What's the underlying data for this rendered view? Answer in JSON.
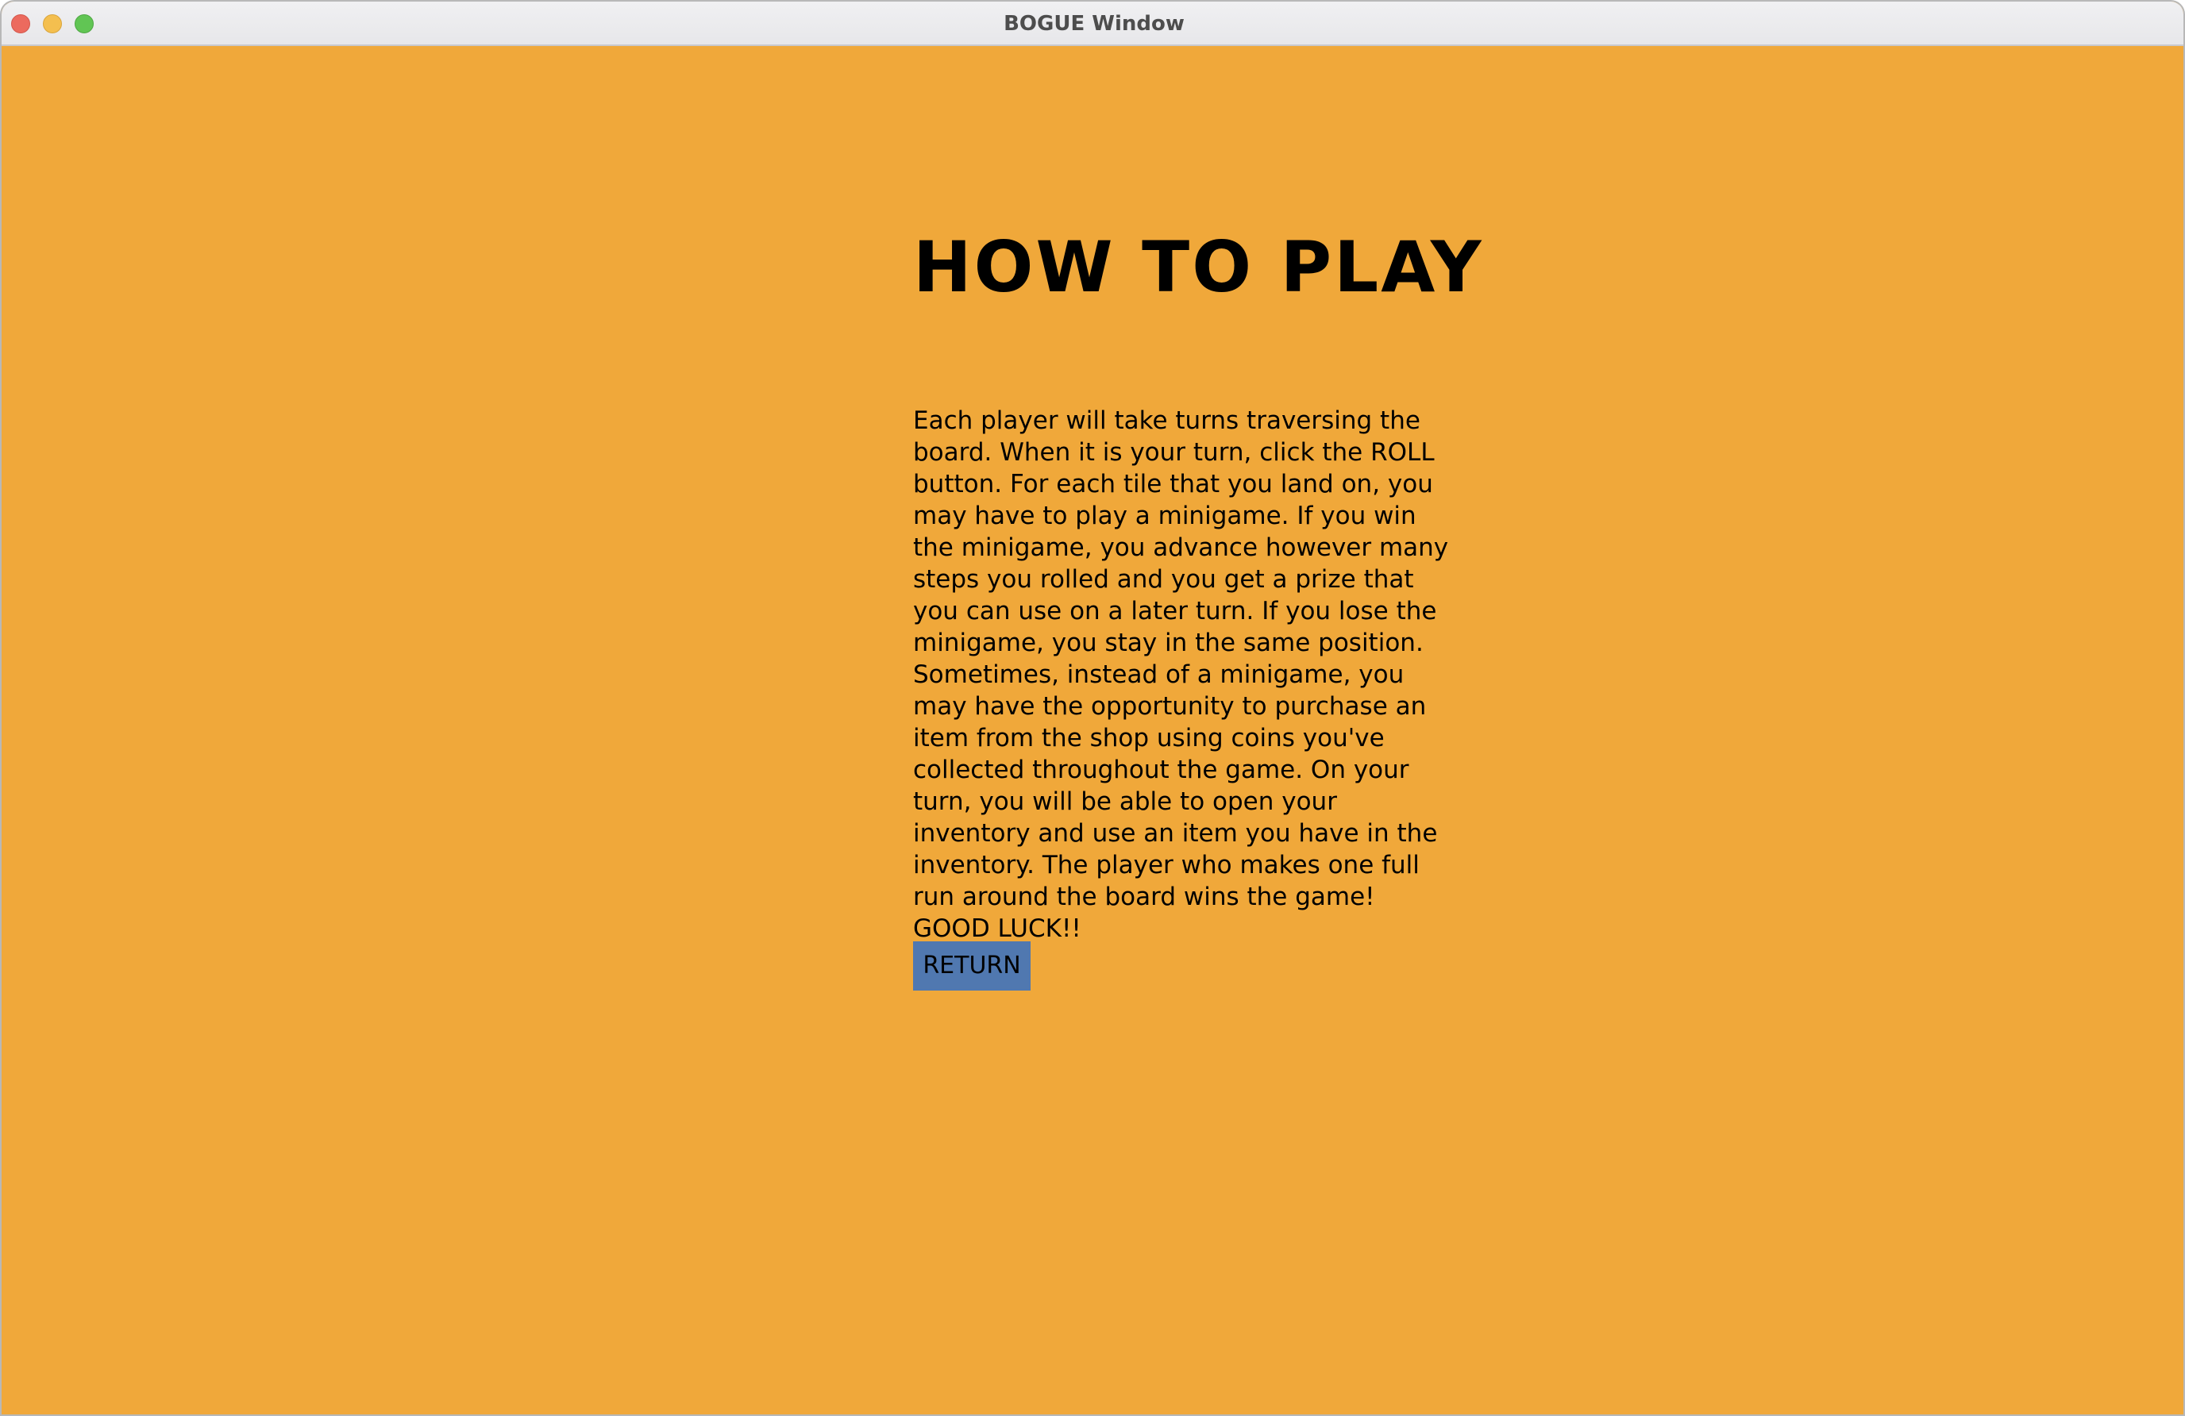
{
  "window": {
    "title": "BOGUE Window",
    "background_color": "#F0A83A",
    "controls": [
      "close-icon",
      "minimize-icon",
      "zoom-icon"
    ]
  },
  "main": {
    "heading": "HOW TO PLAY",
    "instructions": "Each player will take turns traversing the board. When it is your turn, click the ROLL button. For each tile that you land on, you may have to play a minigame. If you win the minigame, you advance however many steps you rolled and you get a prize that you can use on a later turn. If you lose the minigame, you stay in the same position. Sometimes, instead of a minigame, you may have the opportunity to purchase an item from the shop using coins you've collected throughout the game. On your turn, you will be able to open your inventory and use an item you have in the inventory. The player who makes one full run around the board wins the game!",
    "closing": "GOOD LUCK!!",
    "return_label": "RETURN",
    "return_color": "#5078B0"
  }
}
